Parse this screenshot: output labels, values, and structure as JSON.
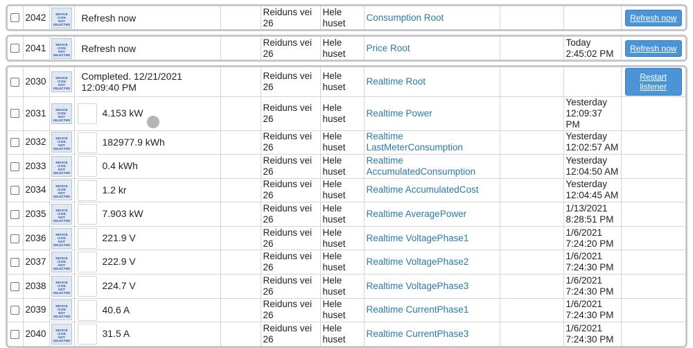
{
  "group1": [
    {
      "id": "2042",
      "status": "Refresh now",
      "value": "",
      "address": "Reiduns vei 26",
      "room": "Hele huset",
      "name": "Consumption Root",
      "time": "",
      "button": "Refresh now"
    }
  ],
  "group2": [
    {
      "id": "2041",
      "status": "Refresh now",
      "value": "",
      "address": "Reiduns vei 26",
      "room": "Hele huset",
      "name": "Price Root",
      "time": "Today 2:45:02 PM",
      "button": "Refresh now"
    }
  ],
  "group3": [
    {
      "id": "2030",
      "status": "Completed. 12/21/2021 12:09:40 PM",
      "value": "",
      "address": "Reiduns vei 26",
      "room": "Hele huset",
      "name": "Realtime Root",
      "time": "",
      "button": "Restart listener"
    },
    {
      "id": "2031",
      "value": "4.153 kW",
      "address": "Reiduns vei 26",
      "room": "Hele huset",
      "name": "Realtime Power",
      "time": "Yesterday 12:09:37 PM"
    },
    {
      "id": "2032",
      "value": "182977.9 kWh",
      "address": "Reiduns vei 26",
      "room": "Hele huset",
      "name": "Realtime LastMeterConsumption",
      "time": "Yesterday 12:02:57 AM"
    },
    {
      "id": "2033",
      "value": "0.4 kWh",
      "address": "Reiduns vei 26",
      "room": "Hele huset",
      "name": "Realtime AccumulatedConsumption",
      "time": "Yesterday 12:04:50 AM"
    },
    {
      "id": "2034",
      "value": "1.2 kr",
      "address": "Reiduns vei 26",
      "room": "Hele huset",
      "name": "Realtime AccumulatedCost",
      "time": "Yesterday 12:04:45 AM"
    },
    {
      "id": "2035",
      "value": "7.903 kW",
      "address": "Reiduns vei 26",
      "room": "Hele huset",
      "name": "Realtime AveragePower",
      "time": "1/13/2021 8:28:51 PM"
    },
    {
      "id": "2036",
      "value": "221.9 V",
      "address": "Reiduns vei 26",
      "room": "Hele huset",
      "name": "Realtime VoltagePhase1",
      "time": "1/6/2021 7:24:20 PM"
    },
    {
      "id": "2037",
      "value": "222.9 V",
      "address": "Reiduns vei 26",
      "room": "Hele huset",
      "name": "Realtime VoltagePhase2",
      "time": "1/6/2021 7:24:30 PM"
    },
    {
      "id": "2038",
      "value": "224.7 V",
      "address": "Reiduns vei 26",
      "room": "Hele huset",
      "name": "Realtime VoltagePhase3",
      "time": "1/6/2021 7:24:30 PM"
    },
    {
      "id": "2039",
      "value": "40.6 A",
      "address": "Reiduns vei 26",
      "room": "Hele huset",
      "name": "Realtime CurrentPhase1",
      "time": "1/6/2021 7:24:30 PM"
    },
    {
      "id": "2040",
      "value": "31.5 A",
      "address": "Reiduns vei 26",
      "room": "Hele huset",
      "name": "Realtime CurrentPhase3",
      "time": "1/6/2021 7:24:30 PM"
    }
  ],
  "thumbnail_text": [
    "DEVICE",
    "ICON",
    "NOT",
    "SELECTED"
  ],
  "colors": {
    "link": "#2b79a8",
    "button": "#4b95d7",
    "group_border": "#c4c7cb"
  }
}
